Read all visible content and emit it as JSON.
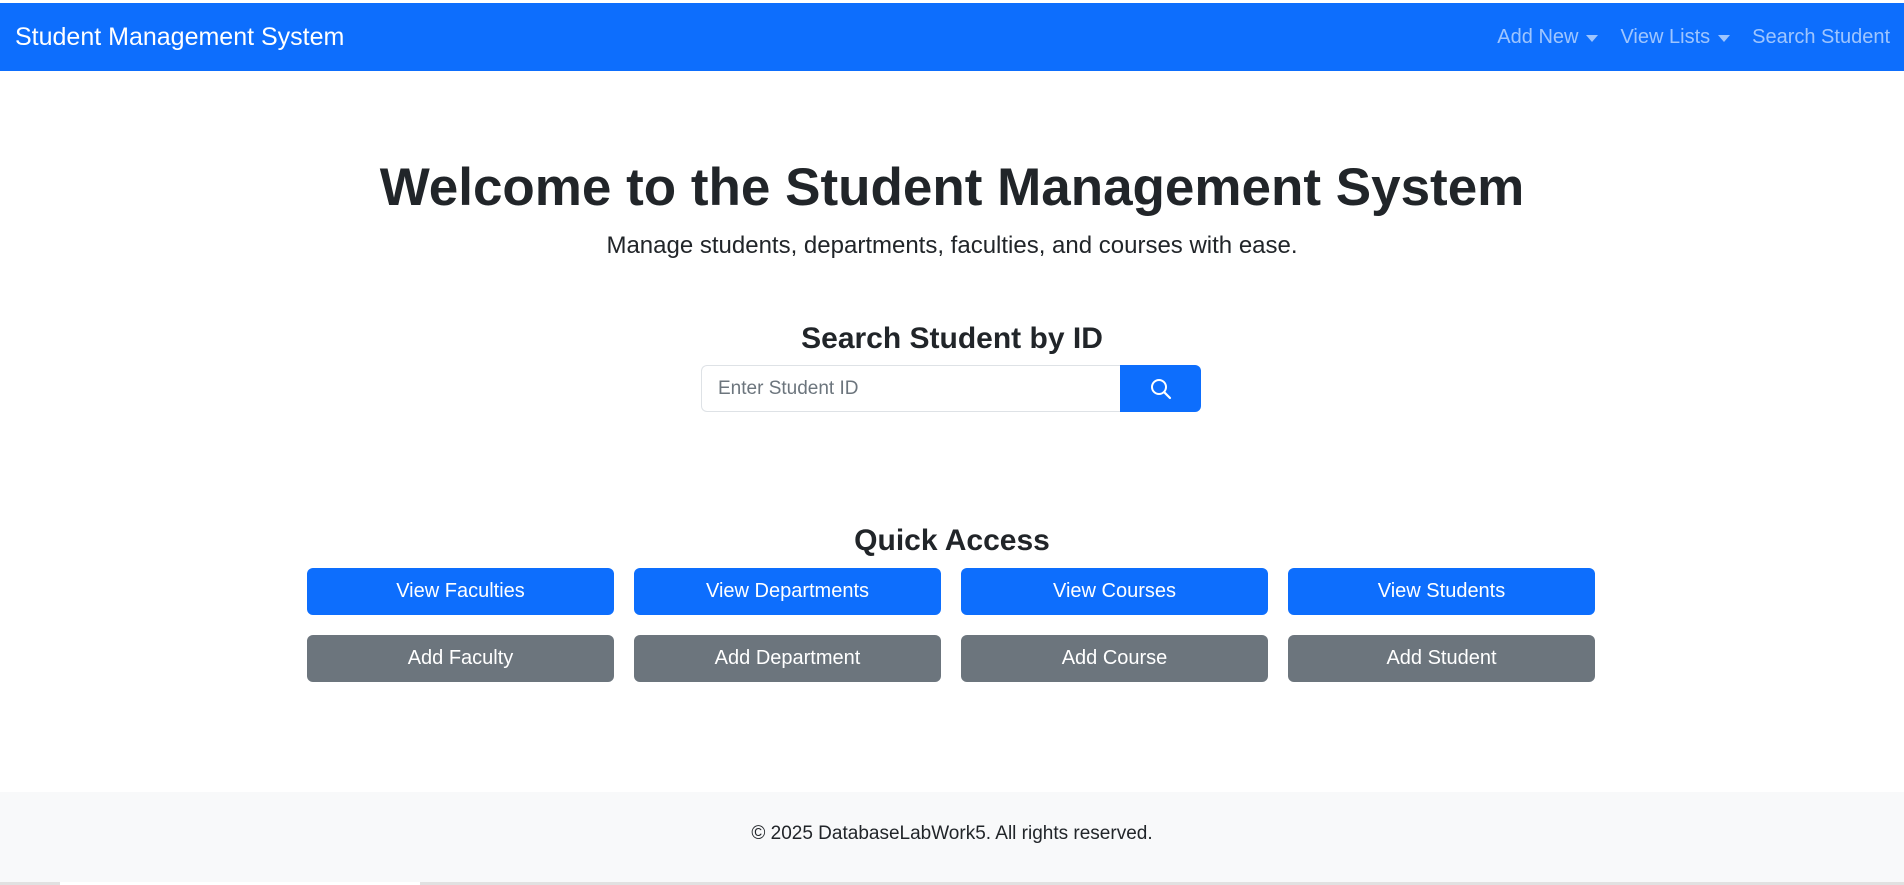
{
  "navbar": {
    "brand": "Student Management System",
    "links": [
      {
        "label": "Add New",
        "dropdown": true
      },
      {
        "label": "View Lists",
        "dropdown": true
      },
      {
        "label": "Search Student",
        "dropdown": false
      }
    ]
  },
  "hero": {
    "title": "Welcome to the Student Management System",
    "subtitle": "Manage students, departments, faculties, and courses with ease."
  },
  "search": {
    "heading": "Search Student by ID",
    "placeholder": "Enter Student ID",
    "value": "",
    "button_icon": "search-icon"
  },
  "quick_access": {
    "heading": "Quick Access",
    "view_buttons": [
      "View Faculties",
      "View Departments",
      "View Courses",
      "View Students"
    ],
    "add_buttons": [
      "Add Faculty",
      "Add Department",
      "Add Course",
      "Add Student"
    ]
  },
  "footer": {
    "text": "© 2025 DatabaseLabWork5. All rights reserved."
  },
  "colors": {
    "primary": "#0d6efd",
    "secondary": "#6c757d",
    "footer_bg": "#f8f9fa",
    "text": "#212529"
  }
}
